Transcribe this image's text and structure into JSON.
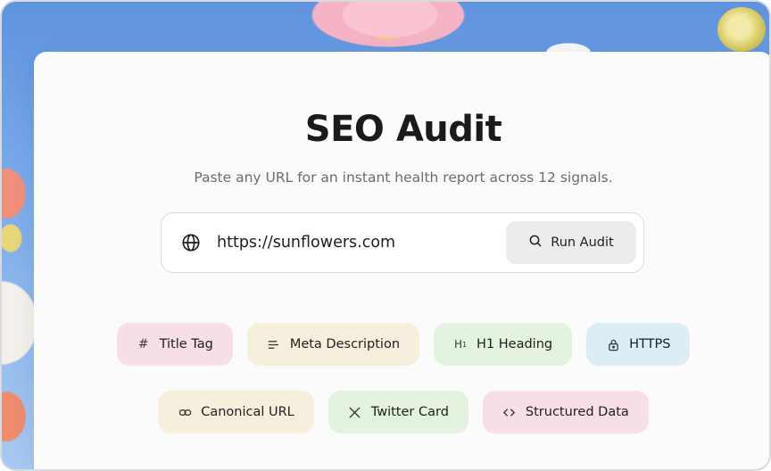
{
  "header": {
    "title": "SEO Audit",
    "subtitle": "Paste any URL for an instant health report across 12 signals."
  },
  "search": {
    "value": "https://sunflowers.com",
    "button_label": "Run Audit",
    "icon": "globe-icon",
    "button_icon": "search-icon"
  },
  "chips": [
    {
      "label": "Title Tag",
      "icon": "hash-icon",
      "color": "#f8dfe6"
    },
    {
      "label": "Meta Description",
      "icon": "text-lines-icon",
      "color": "#f6efdd"
    },
    {
      "label": "H1 Heading",
      "icon": "heading-icon",
      "color": "#e3f3df"
    },
    {
      "label": "HTTPS",
      "icon": "lock-icon",
      "color": "#dcedf6"
    },
    {
      "label": "Canonical URL",
      "icon": "link-icon",
      "color": "#f6efdd"
    },
    {
      "label": "Twitter Card",
      "icon": "x-logo-icon",
      "color": "#e3f3df"
    },
    {
      "label": "Structured Data",
      "icon": "code-icon",
      "color": "#f8dfe6"
    }
  ]
}
